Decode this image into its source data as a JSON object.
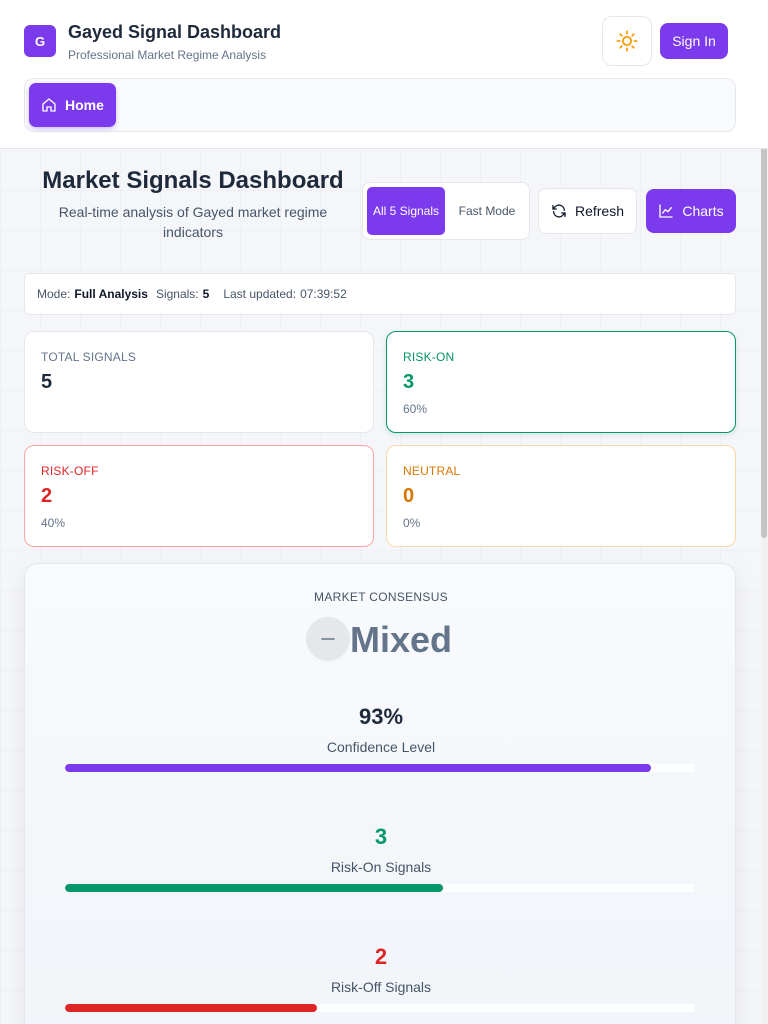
{
  "header": {
    "logo_letter": "G",
    "title": "Gayed Signal Dashboard",
    "subtitle": "Professional Market Regime Analysis",
    "theme_icon": "sun-icon",
    "signin_label": "Sign In"
  },
  "nav": {
    "home_label": "Home",
    "home_icon": "home-icon"
  },
  "dashboard": {
    "title": "Market Signals Dashboard",
    "subtitle": "Real-time analysis of Gayed market regime indicators",
    "mode_all_label": "All 5 Signals",
    "mode_fast_label": "Fast Mode",
    "refresh_label": "Refresh",
    "charts_label": "Charts"
  },
  "status": {
    "mode_label": "Mode:",
    "mode_value": "Full Analysis",
    "signals_label": "Signals:",
    "signals_value": "5",
    "updated_label": "Last updated:",
    "updated_value": "07:39:52"
  },
  "cards": {
    "total": {
      "label": "TOTAL SIGNALS",
      "value": "5"
    },
    "risk_on": {
      "label": "RISK-ON",
      "value": "3",
      "percent": "60%"
    },
    "risk_off": {
      "label": "RISK-OFF",
      "value": "2",
      "percent": "40%"
    },
    "neutral": {
      "label": "NEUTRAL",
      "value": "0",
      "percent": "0%"
    }
  },
  "consensus": {
    "label": "MARKET CONSENSUS",
    "value": "Mixed",
    "icon": "minus-icon",
    "confidence": {
      "value": "93%",
      "label": "Confidence Level",
      "fraction": 0.93
    },
    "risk_on": {
      "value": "3",
      "label": "Risk-On Signals",
      "fraction": 0.6
    },
    "risk_off": {
      "value": "2",
      "label": "Risk-Off Signals",
      "fraction": 0.4
    }
  },
  "colors": {
    "accent": "#7c3aed",
    "risk_on": "#059669",
    "risk_off": "#dc2626",
    "neutral": "#d97706"
  }
}
